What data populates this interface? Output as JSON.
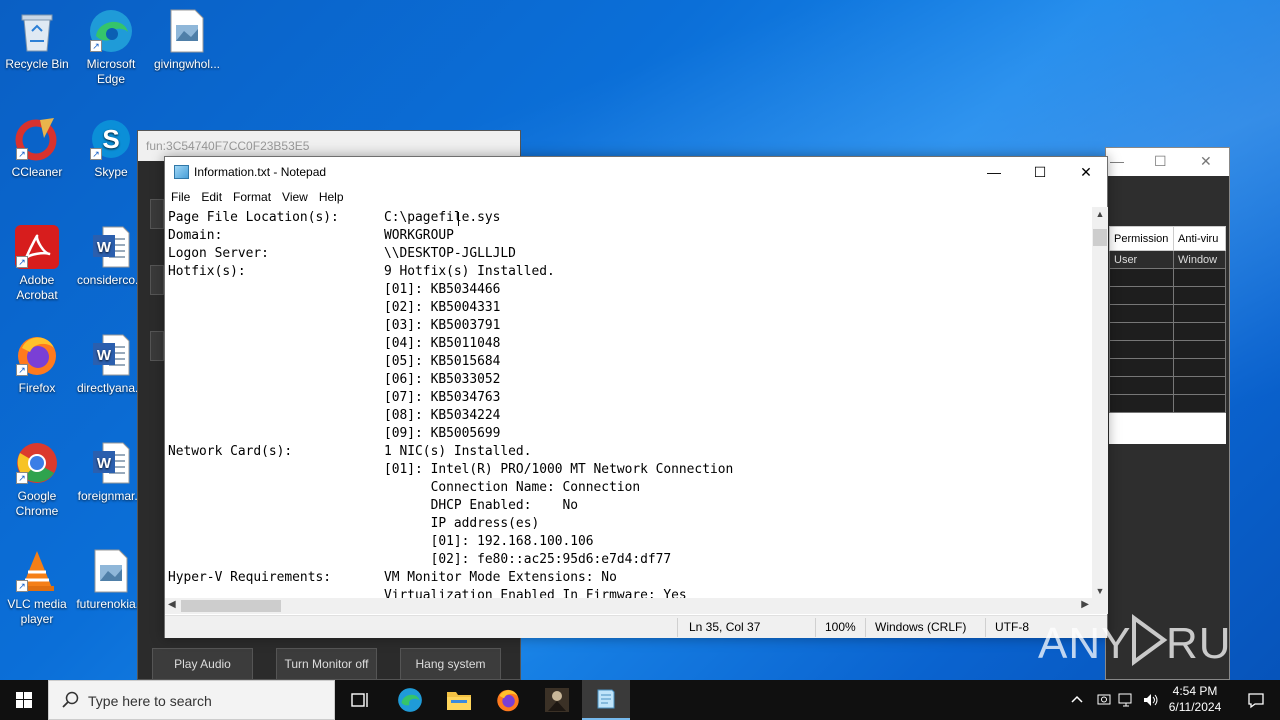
{
  "desktop": {
    "icons": [
      {
        "label": "Recycle Bin"
      },
      {
        "label": "Microsoft Edge"
      },
      {
        "label": "givingwhol..."
      },
      {
        "label": "CCleaner"
      },
      {
        "label": "Skype"
      },
      {
        "label": "Adobe Acrobat"
      },
      {
        "label": "considerco..."
      },
      {
        "label": "Firefox"
      },
      {
        "label": "directlyana..."
      },
      {
        "label": "Google Chrome"
      },
      {
        "label": "foreignmar..."
      },
      {
        "label": "VLC media player"
      },
      {
        "label": "futurenokia..."
      }
    ]
  },
  "bg_window": {
    "title": "fun:3C54740F7CC0F23B53E5",
    "buttons": [
      "Play Audio",
      "Turn Monitor off",
      "Hang system"
    ]
  },
  "right_window": {
    "columns": [
      "Permission",
      "Anti-viru"
    ],
    "first_row": [
      "User",
      "Window"
    ]
  },
  "notepad": {
    "title": "Information.txt - Notepad",
    "menu": [
      "File",
      "Edit",
      "Format",
      "View",
      "Help"
    ],
    "lines": [
      {
        "k": "Page File Location(s):",
        "v": "C:\\pagefile.sys"
      },
      {
        "k": "Domain:",
        "v": "WORKGROUP"
      },
      {
        "k": "Logon Server:",
        "v": "\\\\DESKTOP-JGLLJLD"
      },
      {
        "k": "Hotfix(s):",
        "v": "9 Hotfix(s) Installed."
      },
      {
        "k": "",
        "v": "[01]: KB5034466"
      },
      {
        "k": "",
        "v": "[02]: KB5004331"
      },
      {
        "k": "",
        "v": "[03]: KB5003791"
      },
      {
        "k": "",
        "v": "[04]: KB5011048"
      },
      {
        "k": "",
        "v": "[05]: KB5015684"
      },
      {
        "k": "",
        "v": "[06]: KB5033052"
      },
      {
        "k": "",
        "v": "[07]: KB5034763"
      },
      {
        "k": "",
        "v": "[08]: KB5034224"
      },
      {
        "k": "",
        "v": "[09]: KB5005699"
      },
      {
        "k": "Network Card(s):",
        "v": "1 NIC(s) Installed."
      },
      {
        "k": "",
        "v": "[01]: Intel(R) PRO/1000 MT Network Connection"
      },
      {
        "k": "",
        "v": "      Connection Name: Connection"
      },
      {
        "k": "",
        "v": "      DHCP Enabled:    No"
      },
      {
        "k": "",
        "v": "      IP address(es)"
      },
      {
        "k": "",
        "v": "      [01]: 192.168.100.106"
      },
      {
        "k": "",
        "v": "      [02]: fe80::ac25:95d6:e7d4:df77"
      },
      {
        "k": "Hyper-V Requirements:",
        "v": "VM Monitor Mode Extensions: No"
      },
      {
        "k": "",
        "v": "Virtualization Enabled In Firmware: Yes"
      }
    ],
    "status": {
      "position": "Ln 35, Col 37",
      "zoom": "100%",
      "line_ending": "Windows (CRLF)",
      "encoding": "UTF-8"
    }
  },
  "watermark": "ANY RUN",
  "taskbar": {
    "search_placeholder": "Type here to search",
    "time": "4:54 PM",
    "date": "6/11/2024"
  }
}
